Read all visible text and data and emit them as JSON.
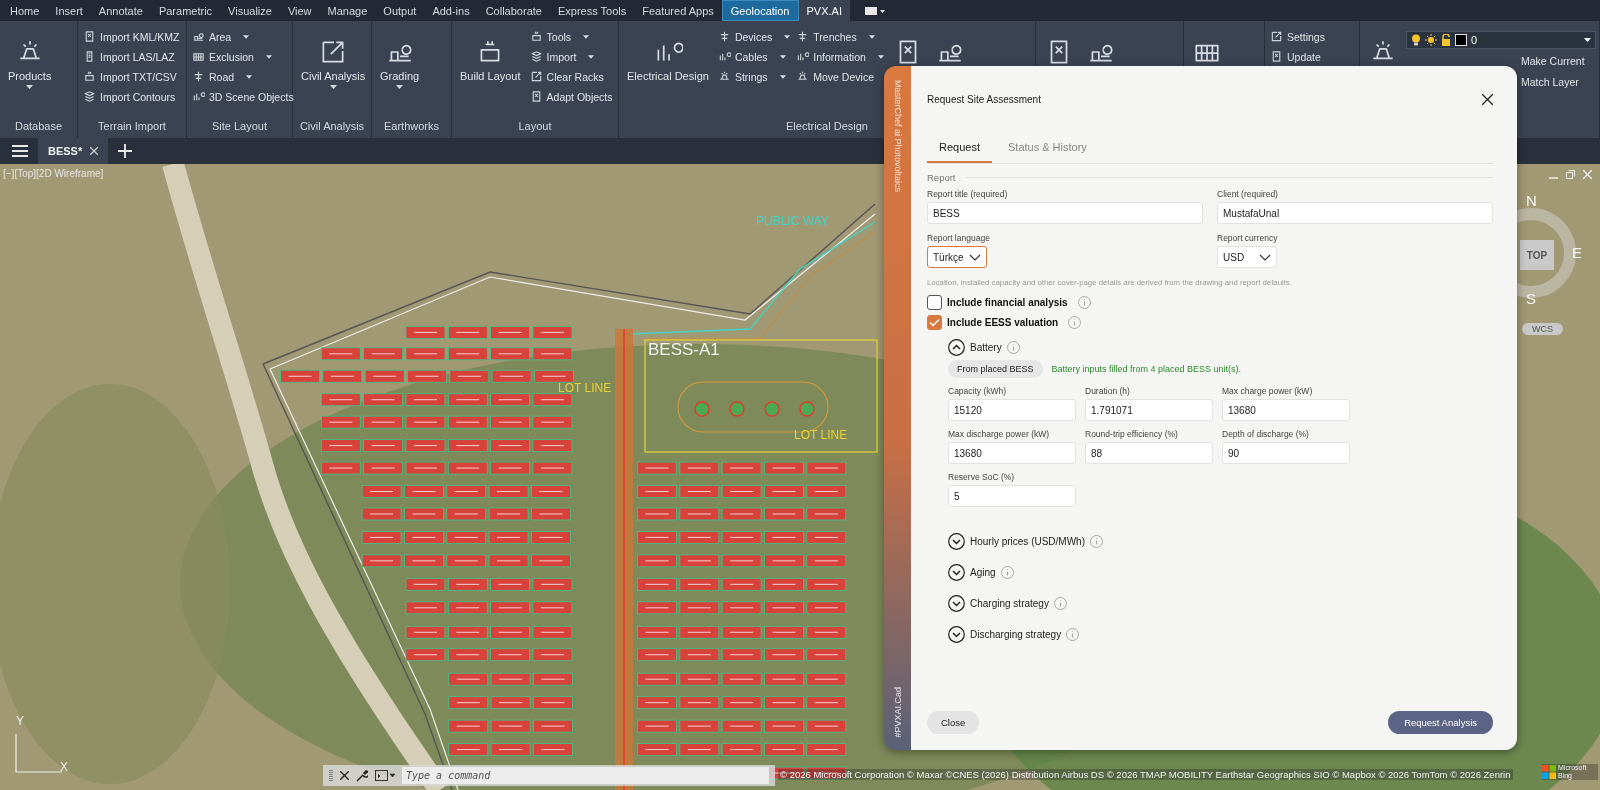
{
  "menu_tabs": [
    {
      "label": "Home",
      "selected": false,
      "highlighted": false
    },
    {
      "label": "Insert",
      "selected": false,
      "highlighted": false
    },
    {
      "label": "Annotate",
      "selected": false,
      "highlighted": false
    },
    {
      "label": "Parametric",
      "selected": false,
      "highlighted": false
    },
    {
      "label": "Visualize",
      "selected": false,
      "highlighted": false
    },
    {
      "label": "View",
      "selected": false,
      "highlighted": false
    },
    {
      "label": "Manage",
      "selected": false,
      "highlighted": false
    },
    {
      "label": "Output",
      "selected": false,
      "highlighted": false
    },
    {
      "label": "Add-ins",
      "selected": false,
      "highlighted": false
    },
    {
      "label": "Collaborate",
      "selected": false,
      "highlighted": false
    },
    {
      "label": "Express Tools",
      "selected": false,
      "highlighted": false
    },
    {
      "label": "Featured Apps",
      "selected": false,
      "highlighted": false
    },
    {
      "label": "Geolocation",
      "selected": false,
      "highlighted": true
    },
    {
      "label": "PVX.AI",
      "selected": true,
      "highlighted": false
    }
  ],
  "ribbon": [
    {
      "title": "Database",
      "columns": [
        {
          "kind": "large",
          "label": "Products",
          "dropdown": true
        }
      ]
    },
    {
      "title": "Terrain Import",
      "columns": [
        {
          "kind": "small",
          "items": [
            {
              "label": "Import KML/KMZ",
              "dropdown": false
            },
            {
              "label": "Import LAS/LAZ",
              "dropdown": false
            },
            {
              "label": "Import TXT/CSV",
              "dropdown": false
            },
            {
              "label": "Import Contours",
              "dropdown": false
            }
          ]
        }
      ]
    },
    {
      "title": "Site Layout",
      "columns": [
        {
          "kind": "small",
          "items": [
            {
              "label": "Area",
              "dropdown": true
            },
            {
              "label": "Exclusion",
              "dropdown": true
            },
            {
              "label": "Road",
              "dropdown": true
            },
            {
              "label": "3D Scene Objects",
              "dropdown": false
            }
          ]
        }
      ]
    },
    {
      "title": "Civil Analysis",
      "columns": [
        {
          "kind": "large",
          "label": "Civil Analysis",
          "dropdown": true
        }
      ]
    },
    {
      "title": "Earthworks",
      "columns": [
        {
          "kind": "large",
          "label": "Grading",
          "dropdown": true
        }
      ]
    },
    {
      "title": "Layout",
      "columns": [
        {
          "kind": "large",
          "label": "Build Layout",
          "dropdown": false
        },
        {
          "kind": "small",
          "items": [
            {
              "label": "Tools",
              "dropdown": true
            },
            {
              "label": "Import",
              "dropdown": true
            },
            {
              "label": "Clear Racks",
              "dropdown": false
            },
            {
              "label": "Adapt Objects",
              "dropdown": false
            }
          ]
        }
      ]
    },
    {
      "title": "Electrical Design",
      "columns": [
        {
          "kind": "large",
          "label": "Electrical Design",
          "dropdown": false
        },
        {
          "kind": "small",
          "items": [
            {
              "label": "Devices",
              "dropdown": true
            },
            {
              "label": "Cables",
              "dropdown": true
            },
            {
              "label": "Strings",
              "dropdown": true
            }
          ]
        },
        {
          "kind": "small",
          "items": [
            {
              "label": "Trenches",
              "dropdown": true
            },
            {
              "label": "Information",
              "dropdown": true
            },
            {
              "label": "Move Device",
              "dropdown": false
            }
          ]
        },
        {
          "kind": "large",
          "dropdown": false
        },
        {
          "kind": "large",
          "dropdown": false
        }
      ]
    },
    {
      "columns": [
        {
          "kind": "large",
          "dropdown": false
        },
        {
          "kind": "large",
          "dropdown": false
        }
      ]
    },
    {
      "columns": [
        {
          "kind": "large",
          "dropdown": false
        }
      ]
    },
    {
      "columns": [
        {
          "kind": "small",
          "items": [
            {
              "label": "Settings",
              "dropdown": false
            },
            {
              "label": "Update",
              "dropdown": false
            }
          ]
        }
      ]
    },
    {
      "columns": [
        {
          "kind": "large",
          "dropdown": false
        },
        {
          "kind": "layer",
          "value": "0",
          "items": [
            {
              "label": "Make Current",
              "dropdown": false
            },
            {
              "label": "Match Layer",
              "dropdown": false
            }
          ]
        }
      ]
    }
  ],
  "doc_tabs": [
    {
      "label": "BESS*",
      "selected": true
    }
  ],
  "viewport": {
    "label": "[−][Top][2D Wireframe]",
    "map_labels": [
      {
        "text": "PUBLIC WAY",
        "color": "#3fd6c6"
      },
      {
        "text": "BESS-A1",
        "color": "#f2f2f2"
      },
      {
        "text": "LOT LINE",
        "color": "#e8d23a"
      },
      {
        "text": "LOT LINE",
        "color": "#e8d23a"
      }
    ],
    "compass": [
      "N",
      "E",
      "S"
    ],
    "view_cube": "TOP",
    "ucs_badge": "WCS",
    "ucs_axes": [
      "Y",
      "X"
    ]
  },
  "command_line": {
    "placeholder": "Type a command"
  },
  "attribution": "© 2026 Microsoft Corporation © Maxar ©CNES (2026) Distribution Airbus DS © 2026 TMAP MOBILITY Earthstar Geographics  SIO © Mapbox © 2026 TomTom © 2026 Zenrin",
  "map_logo": "Microsoft Bing",
  "dialog": {
    "side_label": "MasterChef ai Photovoltaics",
    "side_tag": "#PVXAI.Cad",
    "title": "Request Site Assessment",
    "tabs": [
      {
        "label": "Request",
        "selected": true
      },
      {
        "label": "Status & History",
        "selected": false
      }
    ],
    "section": "Report",
    "fields": [
      {
        "label": "Report title (required)",
        "value": "BESS",
        "kind": "text",
        "focused": false
      },
      {
        "label": "Client (required)",
        "value": "MustafaUnal",
        "kind": "text",
        "focused": false
      },
      {
        "label": "Report language",
        "value": "Türkçe",
        "kind": "select",
        "focused": true
      },
      {
        "label": "Report currency",
        "value": "USD",
        "kind": "select",
        "focused": false
      }
    ],
    "note": "Location, installed capacity and other cover-page details are derived from the drawing and report defaults.",
    "options": [
      {
        "label": "Include financial analysis",
        "checked": false
      },
      {
        "label": "Include EESS valuation",
        "checked": true
      }
    ],
    "sections": [
      {
        "title": "Battery",
        "expanded": true,
        "button": "From placed BESS",
        "status": "Battery inputs filled from 4 placed BESS unit(s).",
        "fields": [
          {
            "label": "Capacity (kWh)",
            "value": "15120"
          },
          {
            "label": "Duration (h)",
            "value": "1.791071"
          },
          {
            "label": "Max charge power (kW)",
            "value": "13680"
          },
          {
            "label": "Max discharge power (kW)",
            "value": "13680"
          },
          {
            "label": "Round-trip efficiency (%)",
            "value": "88"
          },
          {
            "label": "Depth of discharge (%)",
            "value": "90"
          },
          {
            "label": "Reserve SoC (%)",
            "value": "5"
          }
        ]
      },
      {
        "title": "Hourly prices (USD/MWh)",
        "expanded": false
      },
      {
        "title": "Aging",
        "expanded": false
      },
      {
        "title": "Charging strategy",
        "expanded": false
      },
      {
        "title": "Discharging strategy",
        "expanded": false
      }
    ],
    "buttons": {
      "close": "Close",
      "submit": "Request Analysis"
    }
  }
}
